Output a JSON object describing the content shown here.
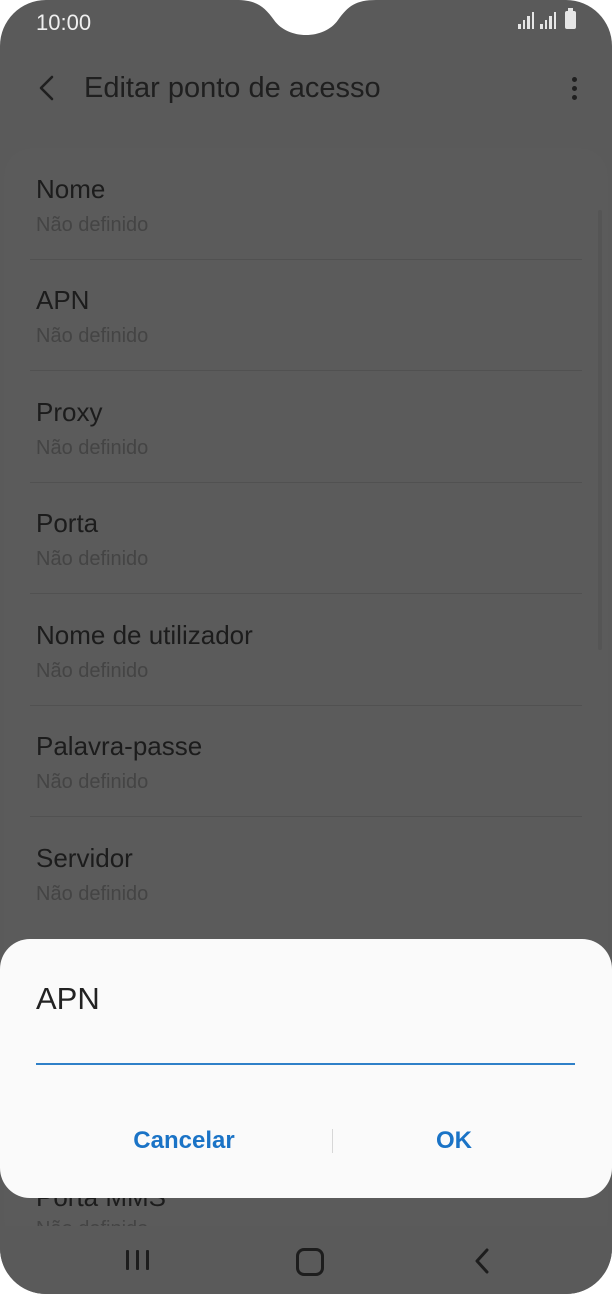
{
  "status": {
    "time": "10:00"
  },
  "appbar": {
    "title": "Editar ponto de acesso"
  },
  "items": [
    {
      "title": "Nome",
      "value": "Não definido"
    },
    {
      "title": "APN",
      "value": "Não definido"
    },
    {
      "title": "Proxy",
      "value": "Não definido"
    },
    {
      "title": "Porta",
      "value": "Não definido"
    },
    {
      "title": "Nome de utilizador",
      "value": "Não definido"
    },
    {
      "title": "Palavra-passe",
      "value": "Não definido"
    },
    {
      "title": "Servidor",
      "value": "Não definido"
    }
  ],
  "peek": {
    "title": "Porta MMS",
    "value": "Não definido"
  },
  "dialog": {
    "title": "APN",
    "input_value": "",
    "cancel_label": "Cancelar",
    "ok_label": "OK"
  },
  "colors": {
    "accent": "#1a73c6",
    "overlay_bg": "#5a5a5a"
  }
}
